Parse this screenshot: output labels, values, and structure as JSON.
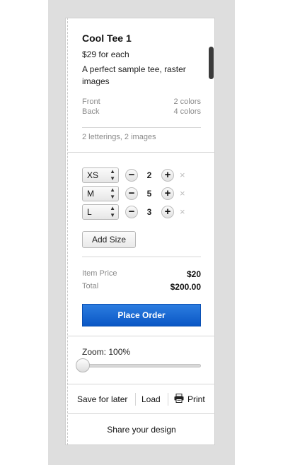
{
  "product": {
    "title": "Cool Tee 1",
    "price": "$29 for each",
    "description": "A perfect sample tee, raster images",
    "specs": [
      {
        "label": "Front",
        "value": "2 colors"
      },
      {
        "label": "Back",
        "value": "4 colors"
      }
    ],
    "summary": "2 letterings, 2 images"
  },
  "sizes": [
    {
      "size": "XS",
      "qty": "2"
    },
    {
      "size": "M",
      "qty": "5"
    },
    {
      "size": "L",
      "qty": "3"
    }
  ],
  "controls": {
    "minus": "−",
    "plus": "+",
    "remove": "×",
    "select_arrows": "▲▼",
    "add_size": "Add Size"
  },
  "pricing": {
    "item_label": "Item Price",
    "item_value": "$20",
    "total_label": "Total",
    "total_value": "$200.00",
    "place_order": "Place Order"
  },
  "zoom": {
    "label": "Zoom: 100%",
    "level": 0
  },
  "actions": {
    "save": "Save for later",
    "load": "Load",
    "print": "Print",
    "share": "Share your design"
  },
  "colors": {
    "accent": "#0a57c5",
    "panel_bg": "#dedede"
  }
}
